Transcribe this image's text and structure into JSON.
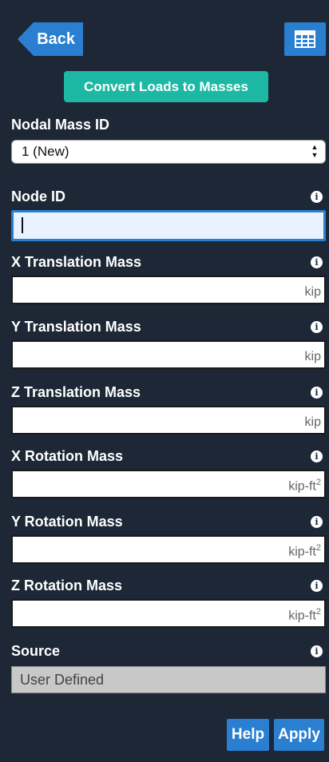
{
  "header": {
    "back_label": "Back",
    "grid_icon": "table-grid-icon"
  },
  "convert_button_label": "Convert Loads to Masses",
  "nodal_mass": {
    "label": "Nodal Mass ID",
    "selected": "1 (New)"
  },
  "fields": {
    "node_id": {
      "label": "Node ID",
      "value": ""
    },
    "x_translation": {
      "label": "X Translation Mass",
      "value": "",
      "unit": "kip"
    },
    "y_translation": {
      "label": "Y Translation Mass",
      "value": "",
      "unit": "kip"
    },
    "z_translation": {
      "label": "Z Translation Mass",
      "value": "",
      "unit": "kip"
    },
    "x_rotation": {
      "label": "X Rotation Mass",
      "value": "",
      "unit": "kip-ft",
      "unit_sup": "2"
    },
    "y_rotation": {
      "label": "Y Rotation Mass",
      "value": "",
      "unit": "kip-ft",
      "unit_sup": "2"
    },
    "z_rotation": {
      "label": "Z Rotation Mass",
      "value": "",
      "unit": "kip-ft",
      "unit_sup": "2"
    }
  },
  "source": {
    "label": "Source",
    "value": "User Defined"
  },
  "info_glyph": "i",
  "footer": {
    "help_label": "Help",
    "apply_label": "Apply"
  },
  "colors": {
    "background": "#1d2736",
    "primary_button": "#2a7fd1",
    "convert_button": "#1db8a3"
  }
}
